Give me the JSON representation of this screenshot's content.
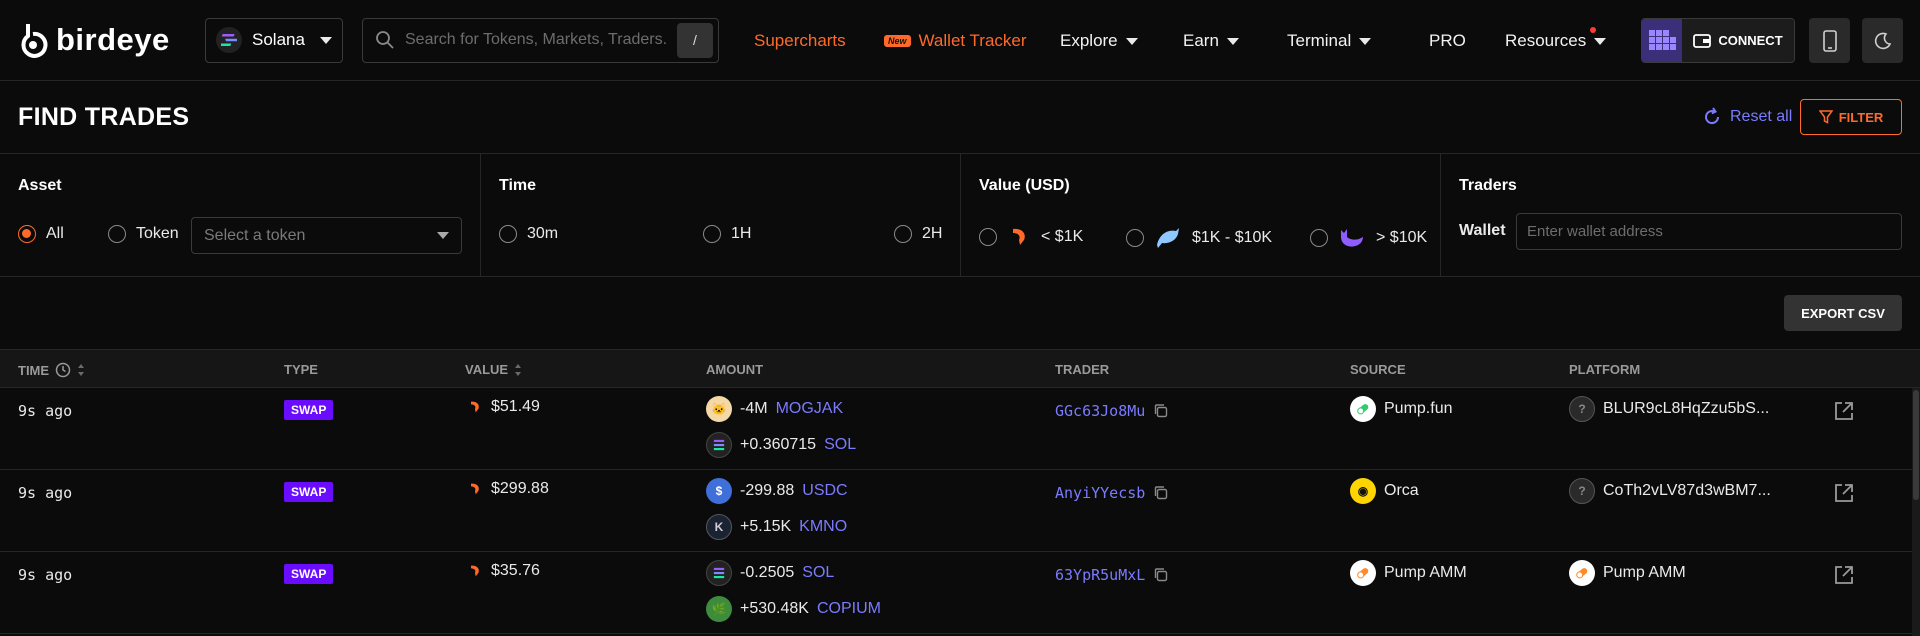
{
  "brand": {
    "name": "birdeye"
  },
  "nav": {
    "chain": "Solana",
    "search_placeholder": "Search for Tokens, Markets, Traders...",
    "search_shortcut": "/",
    "links": [
      {
        "label": "Supercharts"
      },
      {
        "label": "Wallet Tracker",
        "badge": "New"
      },
      {
        "label": "Explore"
      },
      {
        "label": "Earn"
      },
      {
        "label": "Terminal"
      },
      {
        "label": "PRO"
      },
      {
        "label": "Resources"
      }
    ],
    "connect_label": "CONNECT"
  },
  "header": {
    "title": "FIND TRADES",
    "reset_label": "Reset all",
    "filter_label": "FILTER"
  },
  "filters": {
    "asset": {
      "title": "Asset",
      "options": [
        "All",
        "Token"
      ],
      "selected": "All",
      "token_placeholder": "Select a token"
    },
    "time": {
      "title": "Time",
      "options": [
        "30m",
        "1H",
        "2H"
      ]
    },
    "value": {
      "title": "Value (USD)",
      "options": [
        "< $1K",
        "$1K - $10K",
        "> $10K"
      ]
    },
    "traders": {
      "title": "Traders",
      "wallet_label": "Wallet",
      "wallet_placeholder": "Enter wallet address"
    }
  },
  "export_label": "EXPORT CSV",
  "table": {
    "columns": [
      "TIME",
      "TYPE",
      "VALUE",
      "AMOUNT",
      "TRADER",
      "SOURCE",
      "PLATFORM"
    ],
    "rows": [
      {
        "time": "9s ago",
        "type": "SWAP",
        "value": "$51.49",
        "amount1": "-4M",
        "token1": "MOGJAK",
        "amount2": "+0.360715",
        "token2": "SOL",
        "trader": "GGc63Jo8Mu",
        "source": "Pump.fun",
        "platform": "BLUR9cL8HqZzu5bS..."
      },
      {
        "time": "9s ago",
        "type": "SWAP",
        "value": "$299.88",
        "amount1": "-299.88",
        "token1": "USDC",
        "amount2": "+5.15K",
        "token2": "KMNO",
        "trader": "AnyiYYecsb",
        "source": "Orca",
        "platform": "CoTh2vLV87d3wBM7..."
      },
      {
        "time": "9s ago",
        "type": "SWAP",
        "value": "$35.76",
        "amount1": "-0.2505",
        "token1": "SOL",
        "amount2": "+530.48K",
        "token2": "COPIUM",
        "trader": "63YpR5uMxL",
        "source": "Pump AMM",
        "platform": "Pump AMM"
      }
    ]
  },
  "colors": {
    "accent": "#ff6a2b",
    "link": "#7b7bff",
    "swap_badge": "#6a0dff",
    "background": "#0b0b0b"
  }
}
